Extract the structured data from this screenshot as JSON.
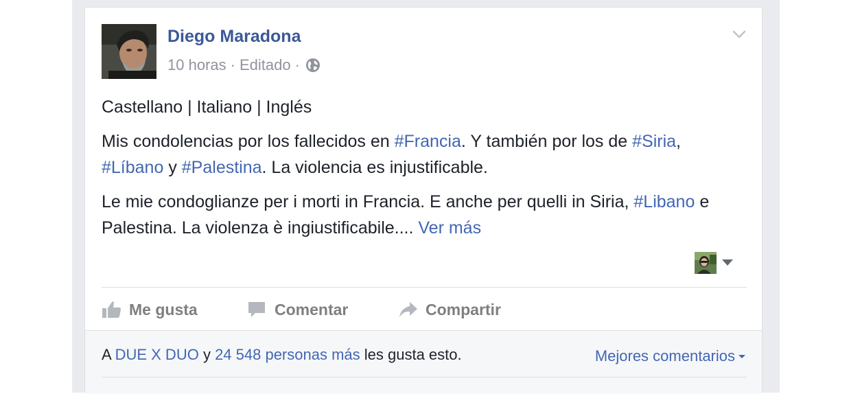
{
  "post": {
    "author": "Diego Maradona",
    "time": "10 horas",
    "edited": "Editado",
    "separator": "·",
    "privacy_icon": "globe-icon",
    "menu_icon": "chevron-down-icon"
  },
  "content": {
    "languages": "Castellano | Italiano | Inglés",
    "p1": {
      "t1": "Mis condolencias por los fallecidos en ",
      "tag_francia": "#Francia",
      "t2": ". Y también por los de ",
      "tag_siria": "#Siria",
      "t3": ", ",
      "tag_libano": "#Líbano",
      "t4": " y ",
      "tag_palestina": "#Palestina",
      "t5": ". La violencia es injustificable."
    },
    "p2": {
      "t1": "Le mie condoglianze per i morti in Francia. E anche per quelli in Siria, ",
      "tag_libano": "#Libano",
      "t2": " e Palestina. La violenza è ingiustificabile.... ",
      "see_more": "Ver más"
    }
  },
  "actions": {
    "like": "Me gusta",
    "comment": "Comentar",
    "share": "Compartir"
  },
  "footer": {
    "prefix": "A ",
    "page_name": "DUE X DUO",
    "connector": " y ",
    "others": "24 548 personas más",
    "suffix": " les gusta esto.",
    "sort_label": "Mejores comentarios"
  },
  "colors": {
    "link": "#4267b2",
    "author": "#3b5998",
    "meta": "#90949c",
    "action": "#7f7f7f",
    "background": "#e9ebee"
  }
}
